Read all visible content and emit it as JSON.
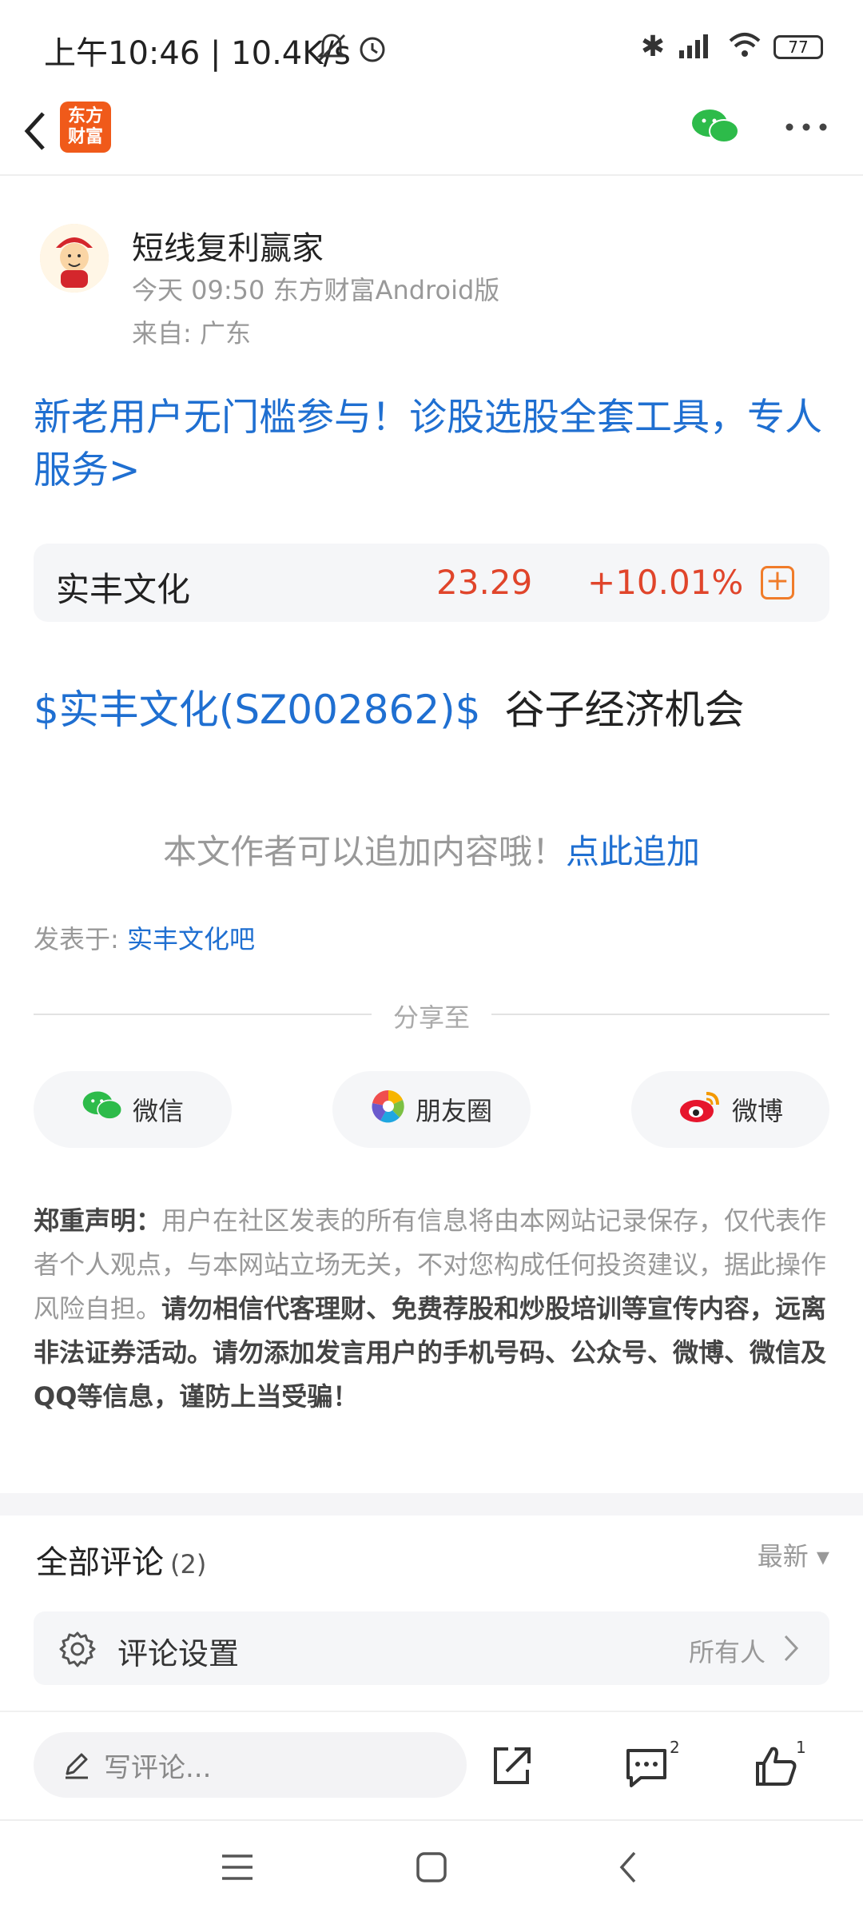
{
  "status_bar": {
    "time": "上午10:46 | 10.4K/s",
    "battery": "77"
  },
  "header": {
    "logo_text": "东方财富"
  },
  "author": {
    "name": "短线复利赢家",
    "time_source": "今天 09:50 东方财富Android版",
    "location": "来自: 广东"
  },
  "promo": {
    "text": "新老用户无门槛参与！诊股选股全套工具，专人服务>"
  },
  "stock": {
    "name": "实丰文化",
    "price": "23.29",
    "change": "+10.01%",
    "add_label": "+"
  },
  "post": {
    "stock_tag": "$实丰文化(SZ002862)$",
    "text": "谷子经济机会"
  },
  "append": {
    "text": "本文作者可以追加内容哦！",
    "link": "点此追加"
  },
  "posted_in": {
    "label": "发表于:",
    "forum": "实丰文化吧"
  },
  "share": {
    "label": "分享至",
    "wechat": "微信",
    "moments": "朋友圈",
    "weibo": "微博"
  },
  "disclaimer": {
    "title": "郑重声明：",
    "body": "用户在社区发表的所有信息将由本网站记录保存，仅代表作者个人观点，与本网站立场无关，不对您构成任何投资建议，据此操作风险自担。",
    "warning": "请勿相信代客理财、免费荐股和炒股培训等宣传内容，远离非法证券活动。请勿添加发言用户的手机号码、公众号、微博、微信及QQ等信息，谨防上当受骗！"
  },
  "comments": {
    "title": "全部评论",
    "count": "(2)",
    "sort": "最新 ▾",
    "settings_label": "评论设置",
    "settings_value": "所有人"
  },
  "bottom": {
    "write_placeholder": "写评论...",
    "comment_count": "2",
    "like_count": "1"
  }
}
